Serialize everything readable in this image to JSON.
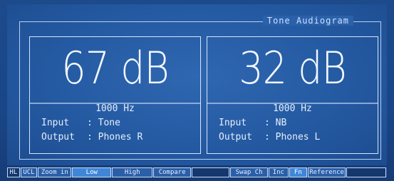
{
  "title": "Tone Audiogram",
  "panels": [
    {
      "level": "67 dB",
      "frequency": "1000 Hz",
      "input_label": "Input",
      "input_value": ": Tone",
      "output_label": "Output",
      "output_value": ": Phones R"
    },
    {
      "level": "32 dB",
      "frequency": "1000 Hz",
      "input_label": "Input",
      "input_value": ": NB",
      "output_label": "Output",
      "output_value": ": Phones L"
    }
  ],
  "statusbar": {
    "hl": "HL",
    "ucl": "UCL",
    "zoom_in": "Zoom in",
    "low": "Low",
    "high": "High",
    "compare": "Compare",
    "swap_ch": "Swap Ch",
    "inc": "Inc",
    "fn": "Fn",
    "reference": "Reference"
  },
  "colors": {
    "screen": "#245aa2",
    "text": "#e6eefc",
    "active_button": "#3f86d8"
  }
}
